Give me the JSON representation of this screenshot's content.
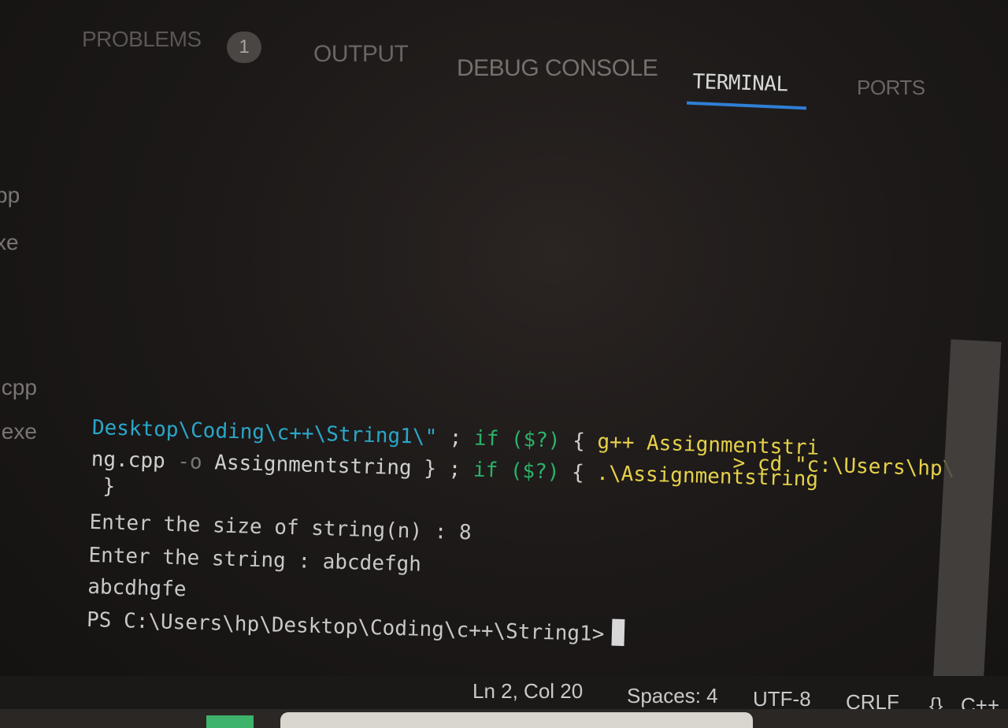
{
  "panel": {
    "tabs": [
      {
        "label": "PROBLEMS",
        "badge": "1"
      },
      {
        "label": "OUTPUT"
      },
      {
        "label": "DEBUG CONSOLE"
      },
      {
        "label": "TERMINAL",
        "active": true
      },
      {
        "label": "PORTS"
      }
    ]
  },
  "explorer": {
    "fragments": [
      "pp",
      "xe",
      ".cpp",
      ".exe"
    ]
  },
  "terminal": {
    "prompt_tail": "> cd \"c:\\Users\\hp\\",
    "line1_path": "Desktop\\Coding\\c++\\String1\\\"",
    "line1_sep": " ; ",
    "line1_if": "if ($?)",
    "line1_brace": " { ",
    "line1_cmd": "g++ Assignmentstri",
    "line2_a": "ng.cpp",
    "line2_flag": " -o ",
    "line2_b": "Assignmentstring } ; ",
    "line2_if": "if ($?)",
    "line2_brace": " { ",
    "line2_cmd": ".\\Assignmentstring",
    "line3": " }",
    "output": [
      "Enter the size of string(n) : 8",
      "Enter the string : abcdefgh",
      "abcdhgfe"
    ],
    "prompt": "PS C:\\Users\\hp\\Desktop\\Coding\\c++\\String1>"
  },
  "statusbar": {
    "position": "Ln 2, Col 20",
    "spaces": "Spaces: 4",
    "encoding": "UTF-8",
    "eol": "CRLF",
    "lang_icon": "{}",
    "language": "C++"
  },
  "colors": {
    "path": "#2aa7c9",
    "command": "#e5d14a",
    "keyword": "#29b36a",
    "active_tab_underline": "#2f7fd6"
  }
}
